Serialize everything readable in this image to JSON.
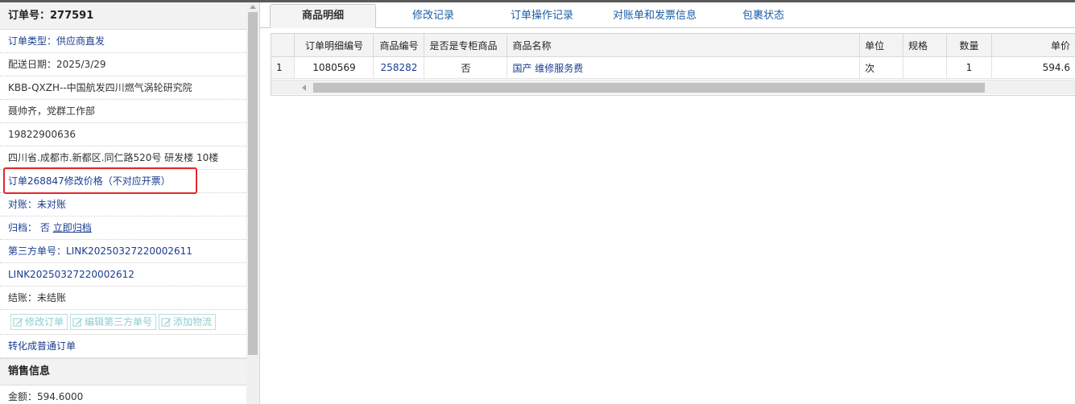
{
  "order": {
    "header": "订单号：277591",
    "type_label": "订单类型：",
    "type_value": "供应商直发",
    "delivery_date": "配送日期：2025/3/29",
    "customer": "KBB-QXZH--中国航发四川燃气涡轮研究院",
    "contact": "聂帅齐，党群工作部",
    "phone": "19822900636",
    "address": "四川省.成都市.新都区.同仁路520号 研发楼 10楼",
    "price_change_note": "订单268847修改价格（不对应开票）",
    "reconcile": "对账：未对账",
    "archive_label": "归档：",
    "archive_value": "否",
    "archive_action": "立即归档",
    "third_party_label": "第三方单号：",
    "third_party_1": "LINK20250327220002611",
    "third_party_2": "LINK20250327220002612",
    "settlement": "结账：未结账",
    "buttons": {
      "edit_order": "修改订单",
      "edit_third_party": "编辑第三方单号",
      "add_logistics": "添加物流"
    },
    "convert_link": "转化成普通订单"
  },
  "sales": {
    "section_title": "销售信息",
    "amount": "金额：594.6000"
  },
  "tabs": [
    {
      "label": "商品明细",
      "active": true
    },
    {
      "label": "修改记录",
      "active": false
    },
    {
      "label": "订单操作记录",
      "active": false
    },
    {
      "label": "对账单和发票信息",
      "active": false
    },
    {
      "label": "包裹状态",
      "active": false
    }
  ],
  "grid": {
    "columns": [
      "",
      "订单明细编号",
      "商品编号",
      "是否是专柜商品",
      "商品名称",
      "单位",
      "规格",
      "数量",
      "单价"
    ],
    "rows": [
      {
        "index": "1",
        "detail_id": "1080569",
        "product_id": "258282",
        "counter_item": "否",
        "name": "国产 维修服务费",
        "unit": "次",
        "spec": "",
        "qty": "1",
        "price": "594.6"
      }
    ]
  },
  "colors": {
    "link": "#1a3d8f",
    "tab_text": "#1b5ea8",
    "highlight": "#e0282b",
    "disabled_button": "#8ccdd4"
  }
}
